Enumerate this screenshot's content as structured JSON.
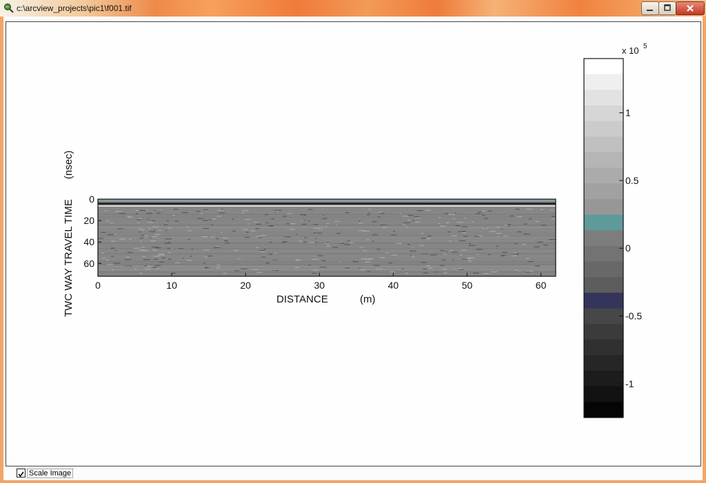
{
  "window": {
    "title": "c:\\arcview_projects\\pic1\\f001.tif",
    "controls": [
      "minimize-icon",
      "maximize-icon",
      "close-icon"
    ]
  },
  "status_bar": {
    "scale_image_label": "Scale Image",
    "scale_image_checked": true
  },
  "chart_data": [
    {
      "type": "heatmap",
      "title": "",
      "xlabel": "DISTANCE",
      "xunit": "(m)",
      "ylabel": "TWC WAY TRAVEL TIME",
      "yunit": "(nsec)",
      "xlim": [
        0,
        62
      ],
      "ylim": [
        0,
        72
      ],
      "y_inverted": true,
      "x_ticks": [
        0,
        10,
        20,
        30,
        40,
        50,
        60
      ],
      "y_ticks": [
        0,
        20,
        40,
        60
      ],
      "description_values": "GPR radargram; reflection amplitudes mostly near 0 with a strong surface reflector at ~5 nsec"
    },
    {
      "type": "colorbar",
      "exponent_label": "x 10",
      "exponent": "5",
      "ticks": [
        "1",
        "0.5",
        "0",
        "-0.5",
        "-1"
      ],
      "tick_values": [
        1,
        0.5,
        0,
        -0.5,
        -1
      ],
      "range": [
        -1.25,
        1.4
      ],
      "colors": [
        "#ffffff",
        "#efefef",
        "#e2e2e2",
        "#d6d6d6",
        "#cbcbcb",
        "#c0c0c0",
        "#b5b5b5",
        "#ababab",
        "#a1a1a1",
        "#979797",
        "#5f9a9b",
        "#7d7d7d",
        "#737373",
        "#686868",
        "#5d5d5d",
        "#35345c",
        "#474747",
        "#3b3b3b",
        "#303030",
        "#262626",
        "#1c1c1c",
        "#121212",
        "#050505"
      ]
    }
  ]
}
